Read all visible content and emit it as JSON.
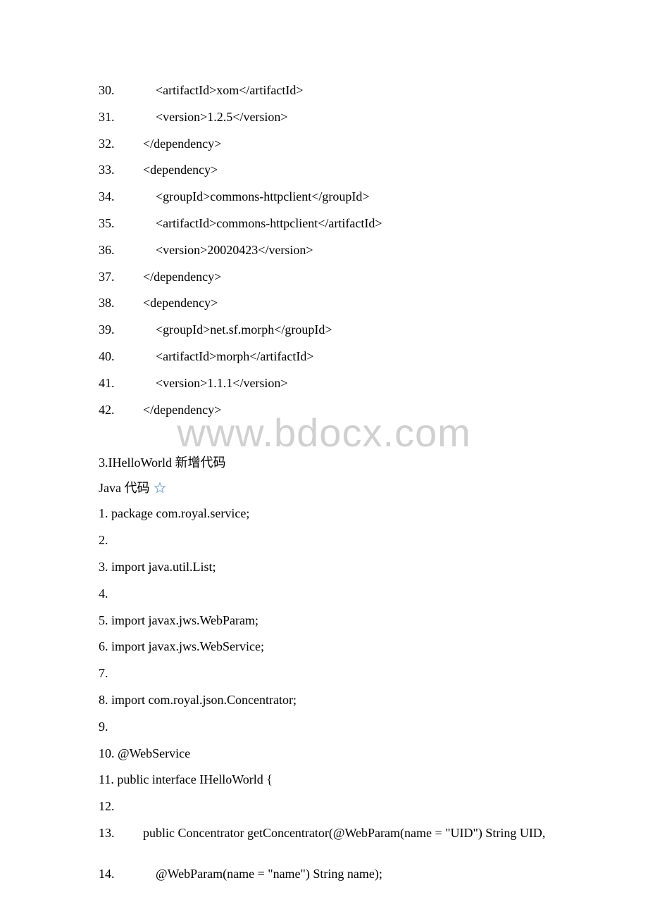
{
  "watermark": "www.bdocx.com",
  "xml_lines": [
    "30.             <artifactId>xom</artifactId>",
    "31.             <version>1.2.5</version>",
    "32.         </dependency>",
    "33.         <dependency>",
    "34.             <groupId>commons-httpclient</groupId>",
    "35.             <artifactId>commons-httpclient</artifactId>",
    "36.             <version>20020423</version>",
    "37.         </dependency>",
    "38.         <dependency>",
    "39.             <groupId>net.sf.morph</groupId>",
    "40.             <artifactId>morph</artifactId>",
    "41.             <version>1.1.1</version>",
    "42.         </dependency>"
  ],
  "section_header": "3.IHelloWorld   新增代码",
  "java_label": "Java 代码",
  "star_icon_name": "favorite-star-icon",
  "java_lines_block1": [
    "1. package com.royal.service;",
    "2.",
    "3. import java.util.List;",
    "4.",
    "5. import javax.jws.WebParam;",
    "6. import javax.jws.WebService;",
    "7.",
    "8. import com.royal.json.Concentrator;",
    "9.",
    "10. @WebService",
    "11. public interface IHelloWorld {",
    "12.",
    "13.         public Concentrator getConcentrator(@WebParam(name = \"UID\") String UID,"
  ],
  "java_lines_block2": [
    "14.             @WebParam(name = \"name\") String name);"
  ]
}
